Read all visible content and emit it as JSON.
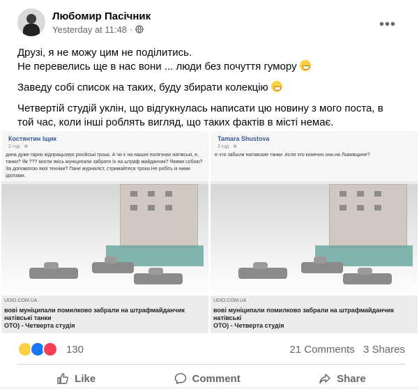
{
  "post": {
    "author": "Любомир Пасічник",
    "time": "Yesterday at 11:48",
    "privacy_icon": "globe-icon",
    "menu_icon": "more-icon",
    "lines": [
      "Друзі, я не можу цим не поділитись.",
      "Не перевелись ще в нас вони ...  люди без почуття гумору",
      "Заведу собі список на таких, буду збирати колекцію",
      "Четвертій студій уклін, що відгукнулась написати цю новину з мого поста, в",
      "той час, коли інші роблять вигляд, що таких фактів в місті немає."
    ]
  },
  "photos": [
    {
      "poster": "Костянтин Іщик",
      "time": "2 год · ⊕",
      "text": "дина дуже гарно відпрацьовує російські гроші. А чи є на наших полігонах натівські, е, танки? Як ??? могли якісь муніципали забрати їх на штраф майданчик? Якими собою? За допомогою якої техніки? Пане журналіст, стримайтеся трохи.Не робіть ік ними ідіотами.",
      "source": "UDIO.COM.UA",
      "caption_1": "вові муніципали помилково забрали на штрафмайданчик натівські танки",
      "caption_2": "ОТО) - Четверта студія"
    },
    {
      "poster": "Tamara Shustova",
      "time": "2 год · ⊕",
      "text": "е.что забыли натовские танки .если это конечно они.на Львовщине?",
      "source": "UDIO.COM.UA",
      "caption_1": "вові муніципали помилково забрали на штрафмайданчик натівські",
      "caption_2": "ОТО) - Четверта студія"
    }
  ],
  "stats": {
    "reactions_count": "130",
    "comments": "21 Comments",
    "shares": "3 Shares"
  },
  "actions": {
    "like": "Like",
    "comment": "Comment",
    "share": "Share"
  },
  "colors": {
    "accent": "#1877f2",
    "text_secondary": "#65676b"
  }
}
